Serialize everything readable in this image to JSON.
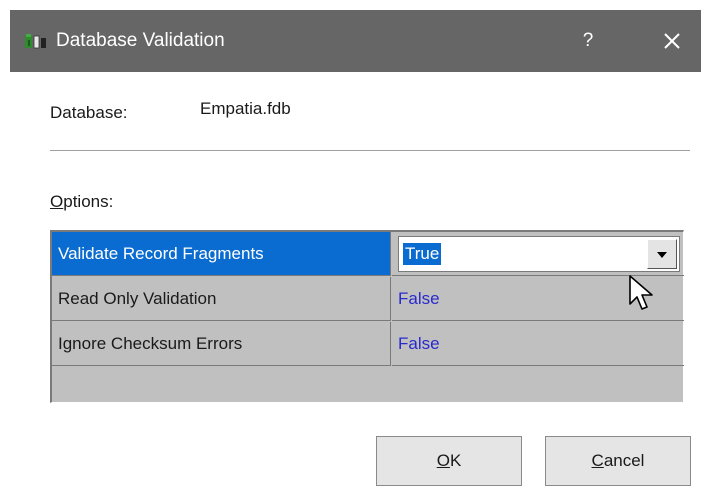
{
  "window": {
    "title": "Database Validation",
    "help_label": "?",
    "icons": {
      "app": "database-validation-app-icon",
      "close": "close-icon"
    }
  },
  "database": {
    "label": "Database:",
    "value": "Empatia.fdb"
  },
  "options": {
    "label": "Options:",
    "rows": [
      {
        "name": "Validate Record Fragments",
        "value": "True",
        "selected": true
      },
      {
        "name": "Read Only Validation",
        "value": "False",
        "selected": false
      },
      {
        "name": "Ignore Checksum Errors",
        "value": "False",
        "selected": false
      }
    ]
  },
  "buttons": {
    "ok": "OK",
    "cancel": "Cancel"
  },
  "colors": {
    "titlebar": "#666666",
    "selection": "#0a6cd0",
    "value_text": "#2a2acc",
    "grid_bg": "#c0c0c0"
  }
}
